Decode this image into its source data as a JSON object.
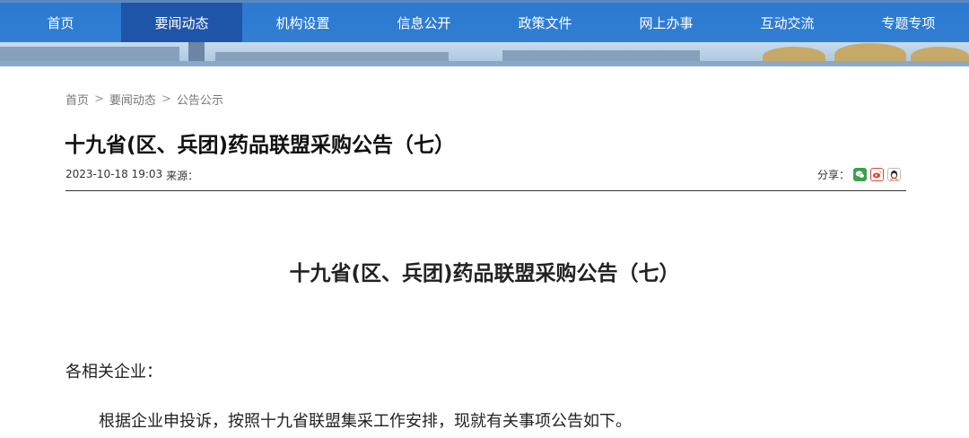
{
  "nav": {
    "items": [
      {
        "label": "首页",
        "active": false
      },
      {
        "label": "要闻动态",
        "active": true
      },
      {
        "label": "机构设置",
        "active": false
      },
      {
        "label": "信息公开",
        "active": false
      },
      {
        "label": "政策文件",
        "active": false
      },
      {
        "label": "网上办事",
        "active": false
      },
      {
        "label": "互动交流",
        "active": false
      },
      {
        "label": "专题专项",
        "active": false
      }
    ],
    "bar_color": "#2878d2",
    "active_color": "#1f55a8"
  },
  "breadcrumb": {
    "items": [
      "首页",
      "要闻动态",
      "公告公示"
    ],
    "separator": ">"
  },
  "article": {
    "title": "十九省(区、兵团)药品联盟采购公告（七）",
    "date": "2023-10-18 19:03",
    "source_label": "来源：",
    "share_label": "分享：",
    "share_icons": [
      "wechat-icon",
      "weibo-icon",
      "qq-icon"
    ],
    "body_title": "十九省(区、兵团)药品联盟采购公告（七）",
    "salutation": "各相关企业：",
    "paragraph_1": "根据企业申投诉，按照十九省联盟集采工作安排，现就有关事项公告如下。"
  }
}
